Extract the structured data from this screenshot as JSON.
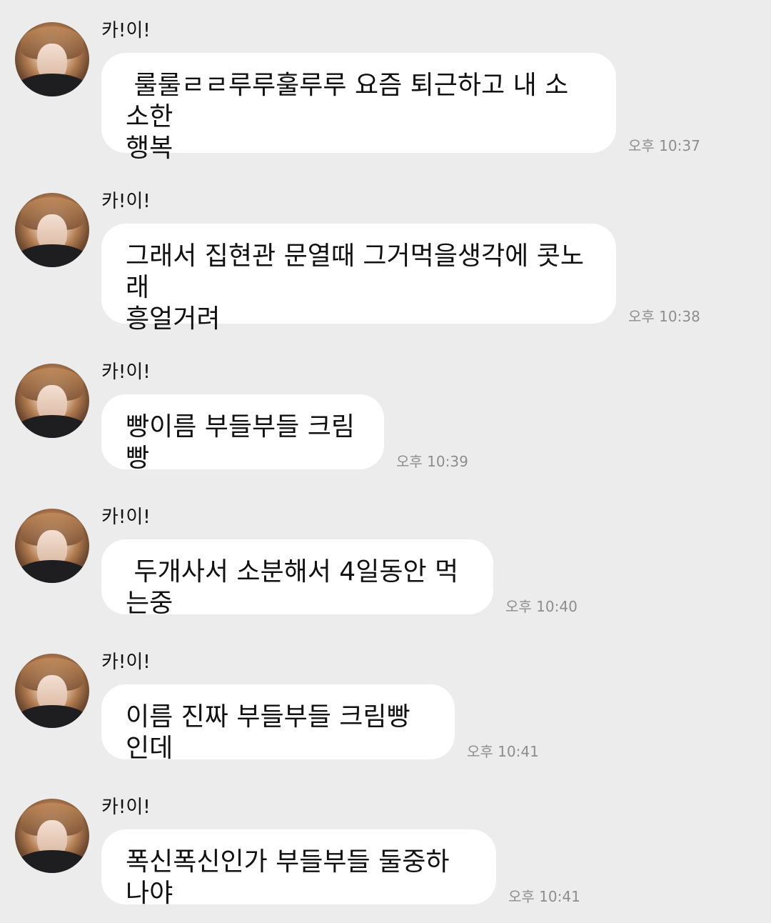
{
  "messages": [
    {
      "sender": "카!이!",
      "text": " 룰룰ㄹㄹ루루훌루루 요즘 퇴근하고 내 소소한\n행복",
      "time": "오후 10:37"
    },
    {
      "sender": "카!이!",
      "text": "그래서 집현관 문열때 그거먹을생각에 콧노래\n흥얼거려",
      "time": "오후 10:38"
    },
    {
      "sender": "카!이!",
      "text": "빵이름 부들부들 크림빵",
      "time": "오후 10:39"
    },
    {
      "sender": "카!이!",
      "text": " 두개사서 소분해서 4일동안 먹는중",
      "time": "오후 10:40"
    },
    {
      "sender": "카!이!",
      "text": "이름 진짜 부들부들 크림빵인데",
      "time": "오후 10:41"
    },
    {
      "sender": "카!이!",
      "text": "폭신폭신인가 부들부들 둘중하나야",
      "time": "오후 10:41"
    }
  ]
}
